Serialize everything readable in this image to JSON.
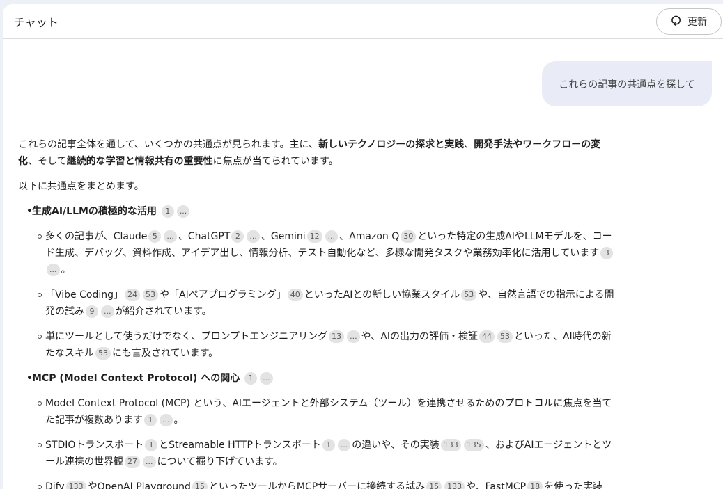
{
  "header": {
    "title": "チャット",
    "refresh_label": "更新"
  },
  "user_message": "これらの記事の共通点を探して",
  "response": {
    "intro": {
      "t1": "これらの記事全体を通して、いくつかの共通点が見られます。主に、",
      "b1": "新しいテクノロジーの探求と実践",
      "t2": "、",
      "b2": "開発手法やワークフローの変化",
      "t3": "、そして",
      "b3": "継続的な学習と情報共有の重要性",
      "t4": "に焦点が当てられています。"
    },
    "summary_lead": "以下に共通点をまとめます。",
    "sections": [
      {
        "heading": "生成AI/LLMの積極的な活用",
        "chips": [
          "1",
          "..."
        ],
        "items": [
          [
            {
              "t": "多くの記事が、Claude"
            },
            {
              "c": "5"
            },
            {
              "c": "..."
            },
            {
              "t": "、ChatGPT"
            },
            {
              "c": "2"
            },
            {
              "c": "..."
            },
            {
              "t": "、Gemini"
            },
            {
              "c": "12"
            },
            {
              "c": "..."
            },
            {
              "t": "、Amazon Q"
            },
            {
              "c": "30"
            },
            {
              "t": "といった特定の生成AIやLLMモデルを、コード生成、デバッグ、資料作成、アイデア出し、情報分析、テスト自動化など、多様な開発タスクや業務効率化に活用しています"
            },
            {
              "c": "3"
            },
            {
              "c": "..."
            },
            {
              "t": "。"
            }
          ],
          [
            {
              "t": "「Vibe Coding」"
            },
            {
              "c": "24"
            },
            {
              "c": "53"
            },
            {
              "t": "や「AIペアプログラミング」"
            },
            {
              "c": "40"
            },
            {
              "t": "といったAIとの新しい協業スタイル"
            },
            {
              "c": "53"
            },
            {
              "t": "や、自然言語での指示による開発の試み"
            },
            {
              "c": "9"
            },
            {
              "c": "..."
            },
            {
              "t": "が紹介されています。"
            }
          ],
          [
            {
              "t": "単にツールとして使うだけでなく、プロンプトエンジニアリング"
            },
            {
              "c": "13"
            },
            {
              "c": "..."
            },
            {
              "t": "や、AIの出力の評価・検証"
            },
            {
              "c": "44"
            },
            {
              "c": "53"
            },
            {
              "t": "といった、AI時代の新たなスキル"
            },
            {
              "c": "53"
            },
            {
              "t": "にも言及されています。"
            }
          ]
        ]
      },
      {
        "heading": "MCP (Model Context Protocol) への関心",
        "chips": [
          "1",
          "..."
        ],
        "items": [
          [
            {
              "t": "Model Context Protocol (MCP) という、AIエージェントと外部システム（ツール）を連携させるためのプロトコルに焦点を当てた記事が複数あります"
            },
            {
              "c": "1"
            },
            {
              "c": "..."
            },
            {
              "t": "。"
            }
          ],
          [
            {
              "t": "STDIOトランスポート"
            },
            {
              "c": "1"
            },
            {
              "t": "とStreamable HTTPトランスポート"
            },
            {
              "c": "1"
            },
            {
              "c": "..."
            },
            {
              "t": "の違いや、その実装"
            },
            {
              "c": "133"
            },
            {
              "c": "135"
            },
            {
              "t": "、およびAIエージェントとツール連携の世界観"
            },
            {
              "c": "27"
            },
            {
              "c": "..."
            },
            {
              "t": "について掘り下げています。"
            }
          ],
          [
            {
              "t": "Dify"
            },
            {
              "c": "133"
            },
            {
              "t": "やOpenAI Playground"
            },
            {
              "c": "15"
            },
            {
              "t": "といったツールからMCPサーバーに接続する試み"
            },
            {
              "c": "15"
            },
            {
              "c": "133"
            },
            {
              "t": "や、FastMCP"
            },
            {
              "c": "18"
            },
            {
              "t": "を使った実装"
            }
          ]
        ]
      }
    ]
  }
}
